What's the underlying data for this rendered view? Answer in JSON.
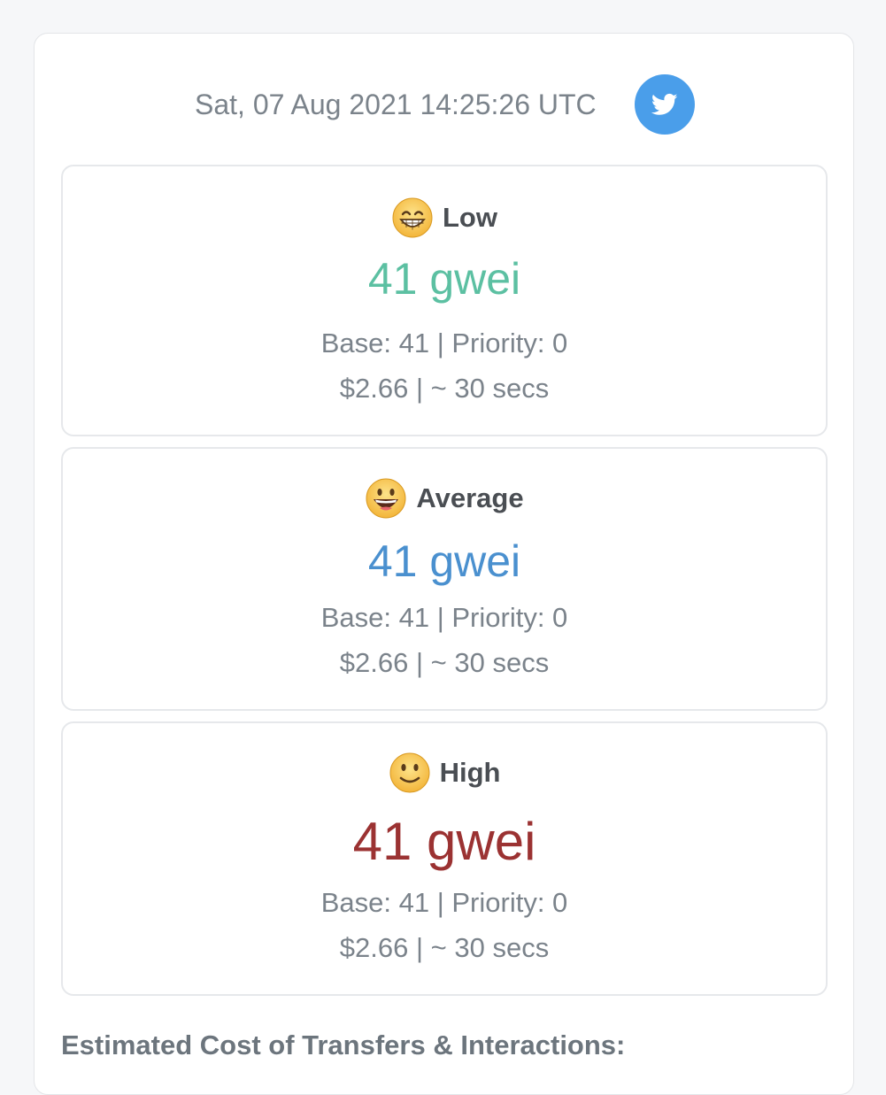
{
  "header": {
    "timestamp": "Sat, 07 Aug 2021 14:25:26 UTC",
    "share_icon": "twitter-icon",
    "share_color": "#4a9eea"
  },
  "tiers": [
    {
      "emoji": "grinning-face-with-smiling-eyes",
      "label": "Low",
      "gwei": "41 gwei",
      "color": "#5cc0a2",
      "base_priority": "Base: 41 | Priority: 0",
      "cost_time": "$2.66 | ~ 30 secs"
    },
    {
      "emoji": "grinning-face-big-eyes",
      "label": "Average",
      "gwei": "41 gwei",
      "color": "#4a90cf",
      "base_priority": "Base: 41 | Priority: 0",
      "cost_time": "$2.66 | ~ 30 secs"
    },
    {
      "emoji": "slightly-smiling-face",
      "label": "High",
      "gwei": "41 gwei",
      "color": "#9b3232",
      "base_priority": "Base: 41 | Priority: 0",
      "cost_time": "$2.66 | ~ 30 secs"
    }
  ],
  "estimated_section": {
    "heading": "Estimated Cost of Transfers & Interactions:"
  }
}
